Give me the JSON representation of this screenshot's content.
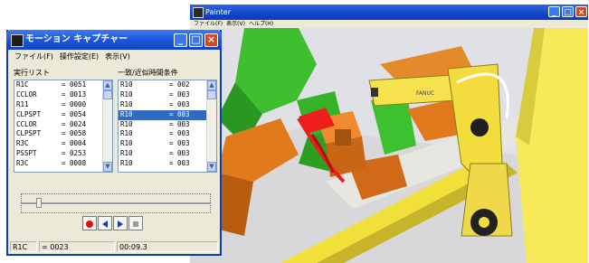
{
  "viewer": {
    "title": "Painter",
    "menu": [
      "ファイル(F)",
      "表示(V)",
      "ヘルプ(H)"
    ],
    "brand_text": "FANUC",
    "colors": {
      "robot_yellow": "#f5e24d",
      "fixture_green": "#3ec12e",
      "part_orange": "#e0791c",
      "weld_red": "#ee1e1e",
      "floor_gray": "#dcdcde"
    }
  },
  "dialog": {
    "title": "モーション キャプチャー",
    "menu": [
      "ファイル(F)",
      "操作設定(E)",
      "表示(V)"
    ],
    "left_list": {
      "label": "実行リスト",
      "rows": [
        {
          "name": "R1C",
          "value": "= 0051"
        },
        {
          "name": "CCLOR",
          "value": "= 0013"
        },
        {
          "name": "R11",
          "value": "= 0000"
        },
        {
          "name": "CLPSPT",
          "value": "= 0054"
        },
        {
          "name": "CCLOR",
          "value": "= 0024"
        },
        {
          "name": "CLPSPT",
          "value": "= 0058"
        },
        {
          "name": "R3C",
          "value": "= 0004"
        },
        {
          "name": "PSSPT",
          "value": "= 0253"
        },
        {
          "name": "R3C",
          "value": "= 0008"
        }
      ]
    },
    "right_list": {
      "label": "一致/近似時間条件",
      "rows": [
        {
          "name": "R10",
          "value": "= 002"
        },
        {
          "name": "R10",
          "value": "= 003"
        },
        {
          "name": "R10",
          "value": "= 003"
        },
        {
          "name": "R10",
          "value": "= 003"
        },
        {
          "name": "R10",
          "value": "= 003"
        },
        {
          "name": "R10",
          "value": "= 003"
        },
        {
          "name": "R10",
          "value": "= 003"
        },
        {
          "name": "R10",
          "value": "= 003"
        },
        {
          "name": "R10",
          "value": "= 003"
        }
      ],
      "selected_index": 3
    },
    "timeline_position": 0.08,
    "buttons": [
      "record-button",
      "prev-button",
      "play-button",
      "stop-button"
    ],
    "status": {
      "register": "R1C",
      "value": "= 0023",
      "time": "00:09.3"
    }
  }
}
